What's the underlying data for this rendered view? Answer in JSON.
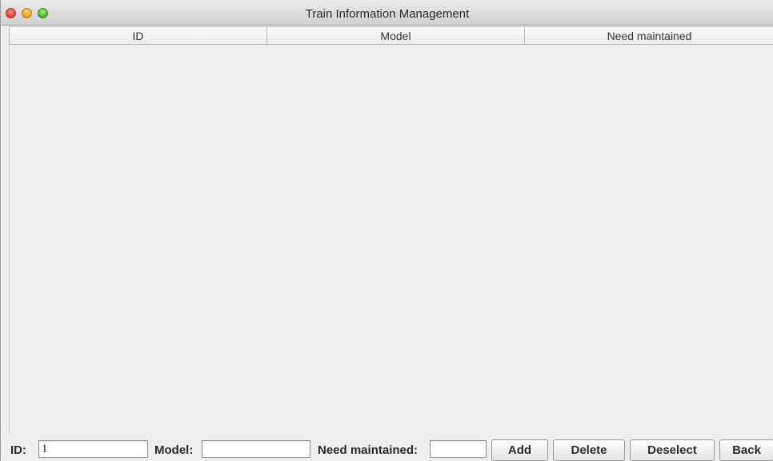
{
  "window": {
    "title": "Train Information Management"
  },
  "table": {
    "columns": [
      "ID",
      "Model",
      "Need maintained"
    ],
    "rows": []
  },
  "form": {
    "id_label": "ID:",
    "id_value": "1",
    "model_label": "Model:",
    "model_value": "",
    "need_label": "Need maintained:",
    "need_value": ""
  },
  "buttons": {
    "add": "Add",
    "delete": "Delete",
    "deselect": "Deselect",
    "back": "Back"
  },
  "icons": {
    "close": "close-traffic-light-icon",
    "minimize": "minimize-traffic-light-icon",
    "maximize": "maximize-traffic-light-icon"
  },
  "colors": {
    "close": "#e0443a",
    "minimize": "#f0a422",
    "maximize": "#4bbf2c"
  }
}
